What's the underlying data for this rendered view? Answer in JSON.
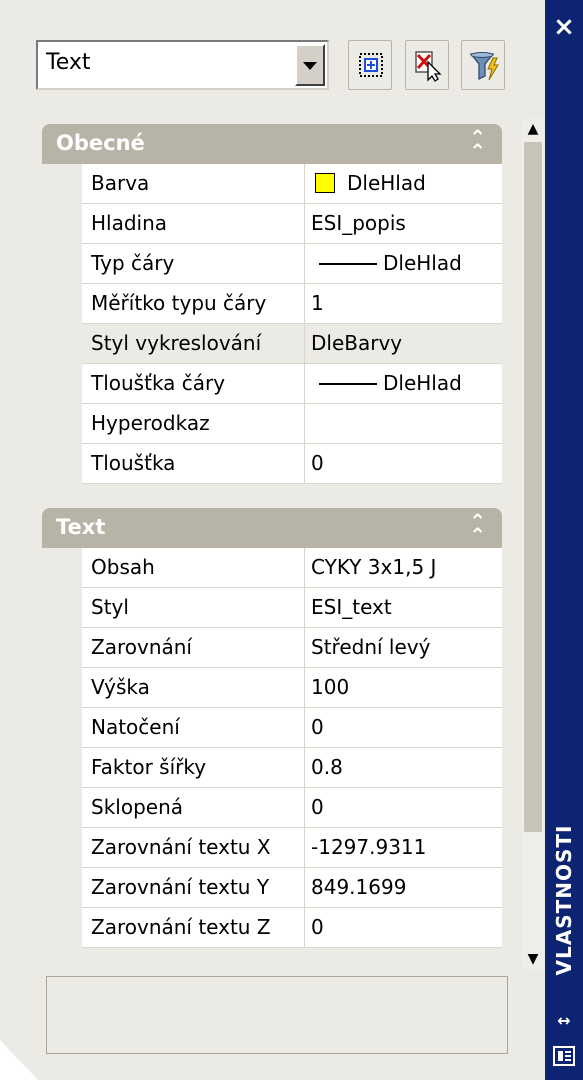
{
  "window": {
    "title": "VLASTNOSTI",
    "close_label": "×",
    "autohide_label": "↔",
    "colors": {
      "titlebar": "#0d2472",
      "category": "#b8b3a7",
      "panel": "#eceae4"
    }
  },
  "selector": {
    "value": "Text"
  },
  "toolbar": {
    "buttons": [
      {
        "icon": "quick-select-icon"
      },
      {
        "icon": "select-objects-icon"
      },
      {
        "icon": "filter-icon"
      }
    ]
  },
  "categories": [
    {
      "title": "Obecné",
      "rows": [
        {
          "label": "Barva",
          "value": "DleHlad",
          "swatch": "#ffff00"
        },
        {
          "label": "Hladina",
          "value": "ESI_popis"
        },
        {
          "label": "Typ čáry",
          "value": "DleHlad"
        },
        {
          "label": "Měřítko typu čáry",
          "value": "1"
        },
        {
          "label": "Styl vykreslování",
          "value": "DleBarvy"
        },
        {
          "label": "Tloušťka čáry",
          "value": "DleHlad"
        },
        {
          "label": "Hyperodkaz",
          "value": ""
        },
        {
          "label": "Tloušťka",
          "value": "0"
        }
      ]
    },
    {
      "title": "Text",
      "rows": [
        {
          "label": "Obsah",
          "value": "CYKY 3x1,5 J"
        },
        {
          "label": "Styl",
          "value": "ESI_text"
        },
        {
          "label": "Zarovnání",
          "value": "Střední levý"
        },
        {
          "label": "Výška",
          "value": "100"
        },
        {
          "label": "Natočení",
          "value": "0"
        },
        {
          "label": "Faktor šířky",
          "value": "0.8"
        },
        {
          "label": "Sklopená",
          "value": "0"
        },
        {
          "label": "Zarovnání textu X",
          "value": "-1297.9311"
        },
        {
          "label": "Zarovnání textu Y",
          "value": "849.1699"
        },
        {
          "label": "Zarovnání textu Z",
          "value": "0"
        }
      ]
    }
  ]
}
